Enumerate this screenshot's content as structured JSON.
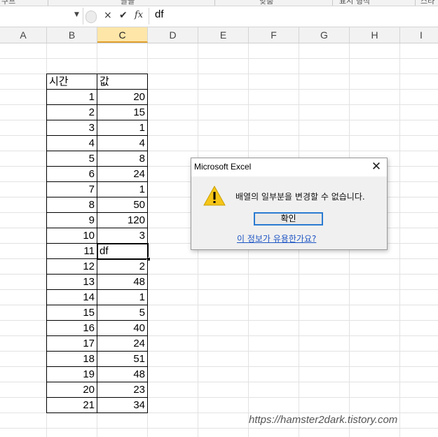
{
  "ribbon": {
    "groups": [
      "쿠프",
      "글꼴",
      "맞춤",
      "표시 형식",
      "스타"
    ]
  },
  "formula_bar": {
    "name_box_value": "",
    "cancel_icon": "×",
    "enter_icon": "✔",
    "fx_label": "fx",
    "content": "df"
  },
  "columns": [
    "A",
    "B",
    "C",
    "D",
    "E",
    "F",
    "G",
    "H",
    "I"
  ],
  "selected_column": "C",
  "table": {
    "header": {
      "time": "시간",
      "value": "값"
    },
    "rows": [
      {
        "time": "1",
        "value": "20"
      },
      {
        "time": "2",
        "value": "15"
      },
      {
        "time": "3",
        "value": "1"
      },
      {
        "time": "4",
        "value": "4"
      },
      {
        "time": "5",
        "value": "8"
      },
      {
        "time": "6",
        "value": "24"
      },
      {
        "time": "7",
        "value": "1"
      },
      {
        "time": "8",
        "value": "50"
      },
      {
        "time": "9",
        "value": "120"
      },
      {
        "time": "10",
        "value": "3"
      },
      {
        "time": "11",
        "value": "df"
      },
      {
        "time": "12",
        "value": "2"
      },
      {
        "time": "13",
        "value": "48"
      },
      {
        "time": "14",
        "value": "1"
      },
      {
        "time": "15",
        "value": "5"
      },
      {
        "time": "16",
        "value": "40"
      },
      {
        "time": "17",
        "value": "24"
      },
      {
        "time": "18",
        "value": "51"
      },
      {
        "time": "19",
        "value": "48"
      },
      {
        "time": "20",
        "value": "23"
      },
      {
        "time": "21",
        "value": "34"
      }
    ]
  },
  "dialog": {
    "title": "Microsoft Excel",
    "close": "✕",
    "message": "배열의 일부분을 변경할 수 없습니다.",
    "ok_label": "확인",
    "help_link": "이 정보가 유용한가요?"
  },
  "watermark": "https://hamster2dark.tistory.com"
}
